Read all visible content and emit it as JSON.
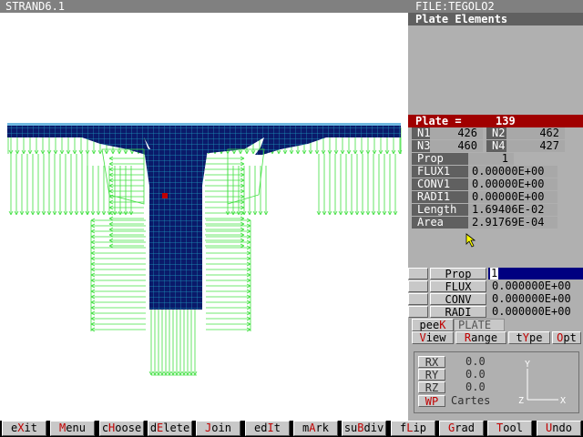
{
  "title": "STRAND6.1",
  "file": "FILE:TEGOLO2",
  "panel_title": "Plate Elements",
  "plate": {
    "label": "Plate =",
    "value": "139"
  },
  "nodes": [
    {
      "label": "N1",
      "value": "426"
    },
    {
      "label": "N2",
      "value": "462"
    },
    {
      "label": "N3",
      "value": "460"
    },
    {
      "label": "N4",
      "value": "427"
    }
  ],
  "props": [
    {
      "label": "Prop",
      "value": "1"
    },
    {
      "label": "FLUX1",
      "value": "0.00000E+00"
    },
    {
      "label": "CONV1",
      "value": "0.00000E+00"
    },
    {
      "label": "RADI1",
      "value": "0.00000E+00"
    },
    {
      "label": "Length",
      "value": "1.69406E-02"
    },
    {
      "label": "Area",
      "value": "2.91769E-04"
    }
  ],
  "edit_fields": [
    {
      "label": "Prop",
      "value": "1"
    },
    {
      "label": "FLUX",
      "value": "0.000000E+00"
    },
    {
      "label": "CONV",
      "value": "0.000000E+00"
    },
    {
      "label": "RADI",
      "value": "0.000000E+00"
    }
  ],
  "tabs_top": [
    {
      "pre": "pee",
      "hot": "K",
      "post": ""
    },
    {
      "pre": "PLATE",
      "hot": "",
      "post": ""
    }
  ],
  "tabs_bottom": [
    {
      "pre": "",
      "hot": "V",
      "post": "iew"
    },
    {
      "pre": "",
      "hot": "R",
      "post": "ange"
    },
    {
      "pre": "t",
      "hot": "Y",
      "post": "pe"
    },
    {
      "pre": "",
      "hot": "O",
      "post": "pt"
    }
  ],
  "rotation": [
    {
      "label": "RX",
      "value": "0.0"
    },
    {
      "label": "RY",
      "value": "0.0"
    },
    {
      "label": "RZ",
      "value": "0.0"
    }
  ],
  "wp": {
    "label": "WP",
    "value": "Cartes"
  },
  "axes": {
    "y": "Y",
    "z": "Z",
    "x": "X"
  },
  "menu": [
    {
      "pre": "e",
      "hot": "X",
      "post": "it"
    },
    {
      "pre": "",
      "hot": "M",
      "post": "enu"
    },
    {
      "pre": "c",
      "hot": "H",
      "post": "oose"
    },
    {
      "pre": "d",
      "hot": "E",
      "post": "lete"
    },
    {
      "pre": "",
      "hot": "J",
      "post": "oin"
    },
    {
      "pre": "ed",
      "hot": "I",
      "post": "t"
    },
    {
      "pre": "m",
      "hot": "A",
      "post": "rk"
    },
    {
      "pre": "su",
      "hot": "B",
      "post": "div"
    },
    {
      "pre": "f",
      "hot": "L",
      "post": "ip"
    },
    {
      "pre": "",
      "hot": "G",
      "post": "rad"
    },
    {
      "pre": "",
      "hot": "T",
      "post": "ool"
    },
    {
      "pre": "",
      "hot": "U",
      "post": "ndo"
    }
  ],
  "colors": {
    "mesh": "#0a1a6a",
    "mesh_line": "#1fa0c0",
    "arrows": "#40e040",
    "plate_bar": "#a00000"
  }
}
